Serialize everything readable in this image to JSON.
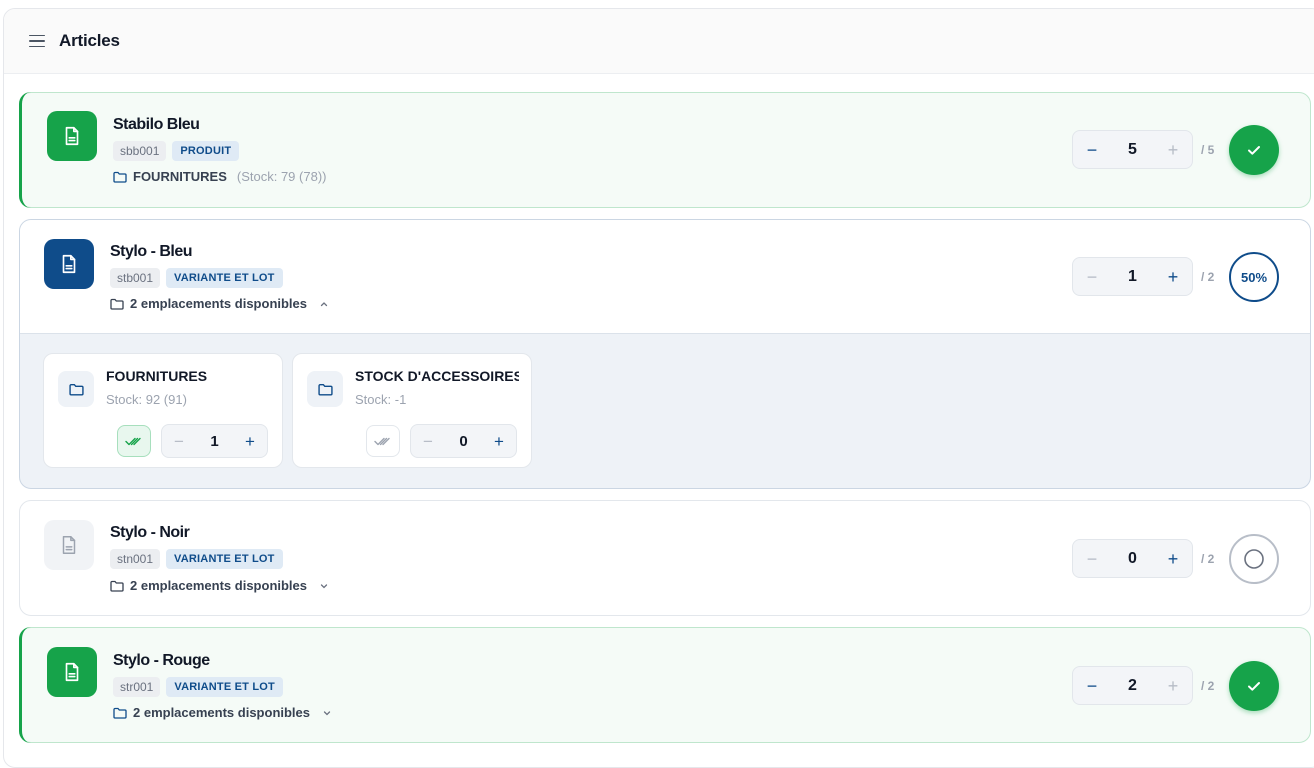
{
  "header": {
    "title": "Articles"
  },
  "articles": [
    {
      "name": "Stabilo Bleu",
      "code": "sbb001",
      "type": "PRODUIT",
      "location": "FOURNITURES",
      "stock": "(Stock: 79 (78))",
      "quantity": "5",
      "minus": "−",
      "plus": "+",
      "total": "/ 5",
      "status": "complete"
    },
    {
      "name": "Stylo - Bleu",
      "code": "stb001",
      "type": "VARIANTE ET LOT",
      "location": "2 emplacements disponibles",
      "quantity": "1",
      "minus": "−",
      "plus": "+",
      "total": "/ 2",
      "status_label": "50%",
      "progress": 0.5,
      "expanded": true,
      "locations": [
        {
          "name": "FOURNITURES",
          "stock": "Stock: 92 (91)",
          "quantity": "1",
          "minus": "−",
          "plus": "+",
          "checked": true
        },
        {
          "name": "STOCK D'ACCESSOIRES",
          "stock": "Stock: -1",
          "quantity": "0",
          "minus": "−",
          "plus": "+",
          "checked": false
        }
      ]
    },
    {
      "name": "Stylo - Noir",
      "code": "stn001",
      "type": "VARIANTE ET LOT",
      "location": "2 emplacements disponibles",
      "quantity": "0",
      "minus": "−",
      "plus": "+",
      "total": "/ 2",
      "status": "empty"
    },
    {
      "name": "Stylo - Rouge",
      "code": "str001",
      "type": "VARIANTE ET LOT",
      "location": "2 emplacements disponibles",
      "quantity": "2",
      "minus": "−",
      "plus": "+",
      "total": "/ 2",
      "status": "complete"
    }
  ],
  "colors": {
    "success": "#16a34a",
    "primary": "#0f4c8a",
    "muted": "#9ca3af"
  },
  "icons": {
    "menu": "menu-icon",
    "document": "document-icon",
    "folder": "folder-icon",
    "check": "check-icon",
    "double-check": "double-check-icon",
    "chevron-up": "chevron-up-icon",
    "chevron-down": "chevron-down-icon"
  }
}
